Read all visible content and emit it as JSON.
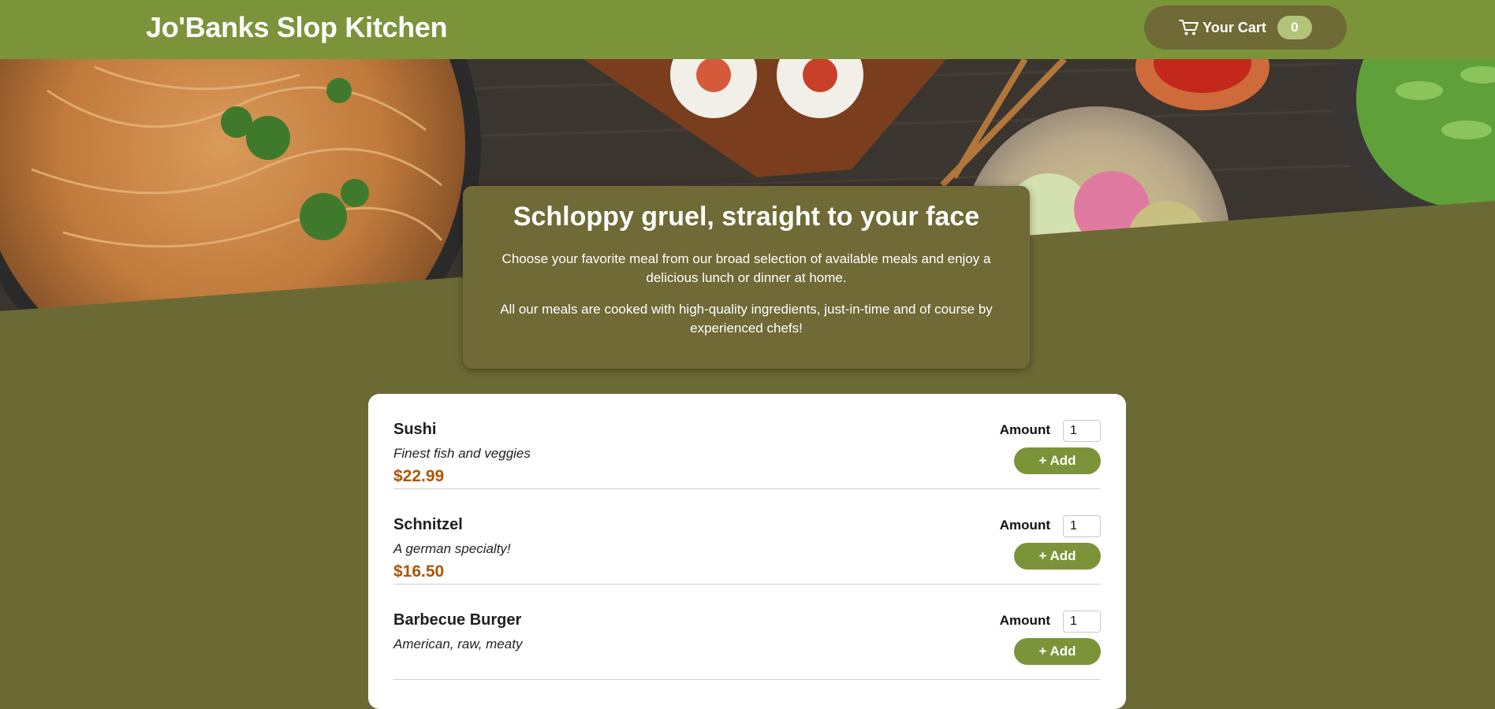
{
  "header": {
    "brand": "Jo'Banks Slop Kitchen",
    "cart_label": "Your Cart",
    "cart_count": "0"
  },
  "summary": {
    "title": "Schloppy gruel, straight to your face",
    "paragraph1": "Choose your favorite meal from our broad selection of available meals and enjoy a delicious lunch or dinner at home.",
    "paragraph2": "All our meals are cooked with high-quality ingredients, just-in-time and of course by experienced chefs!"
  },
  "meals": [
    {
      "name": "Sushi",
      "description": "Finest fish and veggies",
      "price": "$22.99",
      "amount_label": "Amount",
      "amount": "1",
      "add_label": "+ Add"
    },
    {
      "name": "Schnitzel",
      "description": "A german specialty!",
      "price": "$16.50",
      "amount_label": "Amount",
      "amount": "1",
      "add_label": "+ Add"
    },
    {
      "name": "Barbecue Burger",
      "description": "American, raw, meaty",
      "price": "",
      "amount_label": "Amount",
      "amount": "1",
      "add_label": "+ Add"
    }
  ],
  "colors": {
    "header_bg": "#7b943a",
    "page_bg": "#6b6a34",
    "accent_price": "#ad5502"
  }
}
